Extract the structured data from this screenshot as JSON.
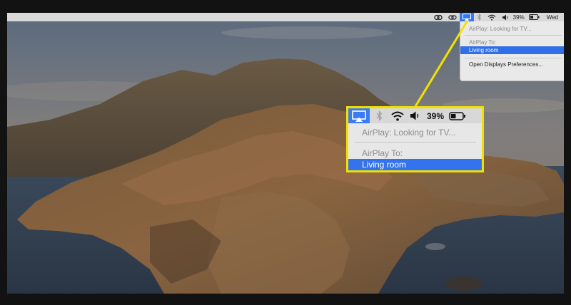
{
  "menubar": {
    "battery_percent": "39%",
    "day": "Wed",
    "icons": [
      "creative-cloud-icon",
      "link-icon",
      "airplay-icon",
      "bluetooth-icon",
      "wifi-icon",
      "volume-icon",
      "battery-icon"
    ]
  },
  "airplay_menu": {
    "status": "AirPlay: Looking for TV...",
    "section_label": "AirPlay To:",
    "selected_device": "Living room",
    "preferences_item": "Open Displays Preferences..."
  },
  "callout": {
    "battery_percent": "39%",
    "status": "AirPlay: Looking for TV...",
    "section_label": "AirPlay To:",
    "selected_device": "Living room"
  },
  "colors": {
    "highlight": "#f2e100",
    "selection": "#3373ee",
    "menubar": "#d9d9d9"
  }
}
